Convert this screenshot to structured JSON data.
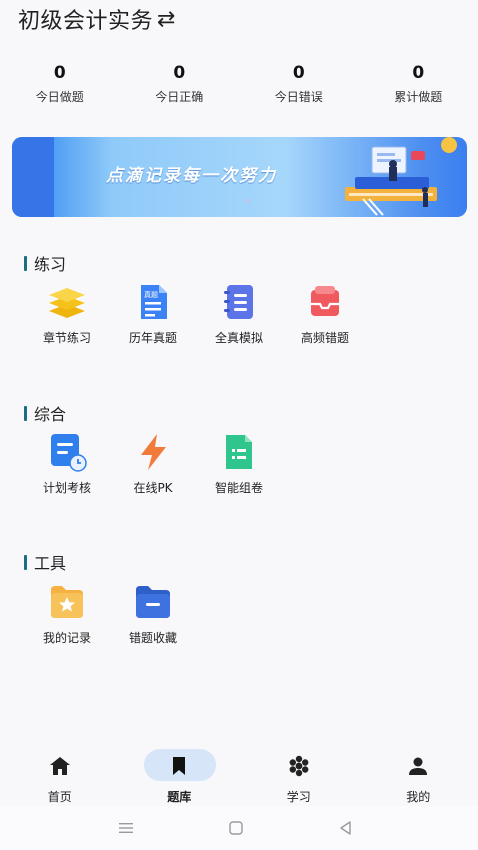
{
  "header": {
    "title": "初级会计实务",
    "switch_icon": "swap-arrows-icon"
  },
  "stats": [
    {
      "value": "0",
      "label": "今日做题"
    },
    {
      "value": "0",
      "label": "今日正确"
    },
    {
      "value": "0",
      "label": "今日错误"
    },
    {
      "value": "0",
      "label": "累计做题"
    }
  ],
  "banner": {
    "slogan": "点滴记录每一次努力"
  },
  "sections": [
    {
      "title": "练习",
      "items": [
        {
          "label": "章节练习",
          "icon": "layers-icon",
          "color": "#f5c21b"
        },
        {
          "label": "历年真题",
          "icon": "document-icon",
          "color": "#3b82f6",
          "tag": "真题"
        },
        {
          "label": "全真模拟",
          "icon": "notebook-icon",
          "color": "#5b74e8"
        },
        {
          "label": "高频错题",
          "icon": "inbox-icon",
          "color": "#f05a5f"
        }
      ]
    },
    {
      "title": "综合",
      "items": [
        {
          "label": "计划考核",
          "icon": "plan-clock-icon",
          "color": "#2f80ed"
        },
        {
          "label": "在线PK",
          "icon": "lightning-icon",
          "color": "#f27a3a"
        },
        {
          "label": "智能组卷",
          "icon": "list-doc-icon",
          "color": "#2fc58d"
        }
      ]
    },
    {
      "title": "工具",
      "items": [
        {
          "label": "我的记录",
          "icon": "star-folder-icon",
          "color": "#f5b243"
        },
        {
          "label": "错题收藏",
          "icon": "folder-icon",
          "color": "#3d72e0"
        }
      ]
    }
  ],
  "tabbar": [
    {
      "label": "首页",
      "icon": "home-icon",
      "active": false
    },
    {
      "label": "题库",
      "icon": "bookmark-icon",
      "active": true
    },
    {
      "label": "学习",
      "icon": "hexagons-icon",
      "active": false
    },
    {
      "label": "我的",
      "icon": "person-icon",
      "active": false
    }
  ],
  "colors": {
    "accent": "#1c6d80",
    "active_tab_bg": "#d6e6f8",
    "banner_blue": "#3b7ef0"
  }
}
